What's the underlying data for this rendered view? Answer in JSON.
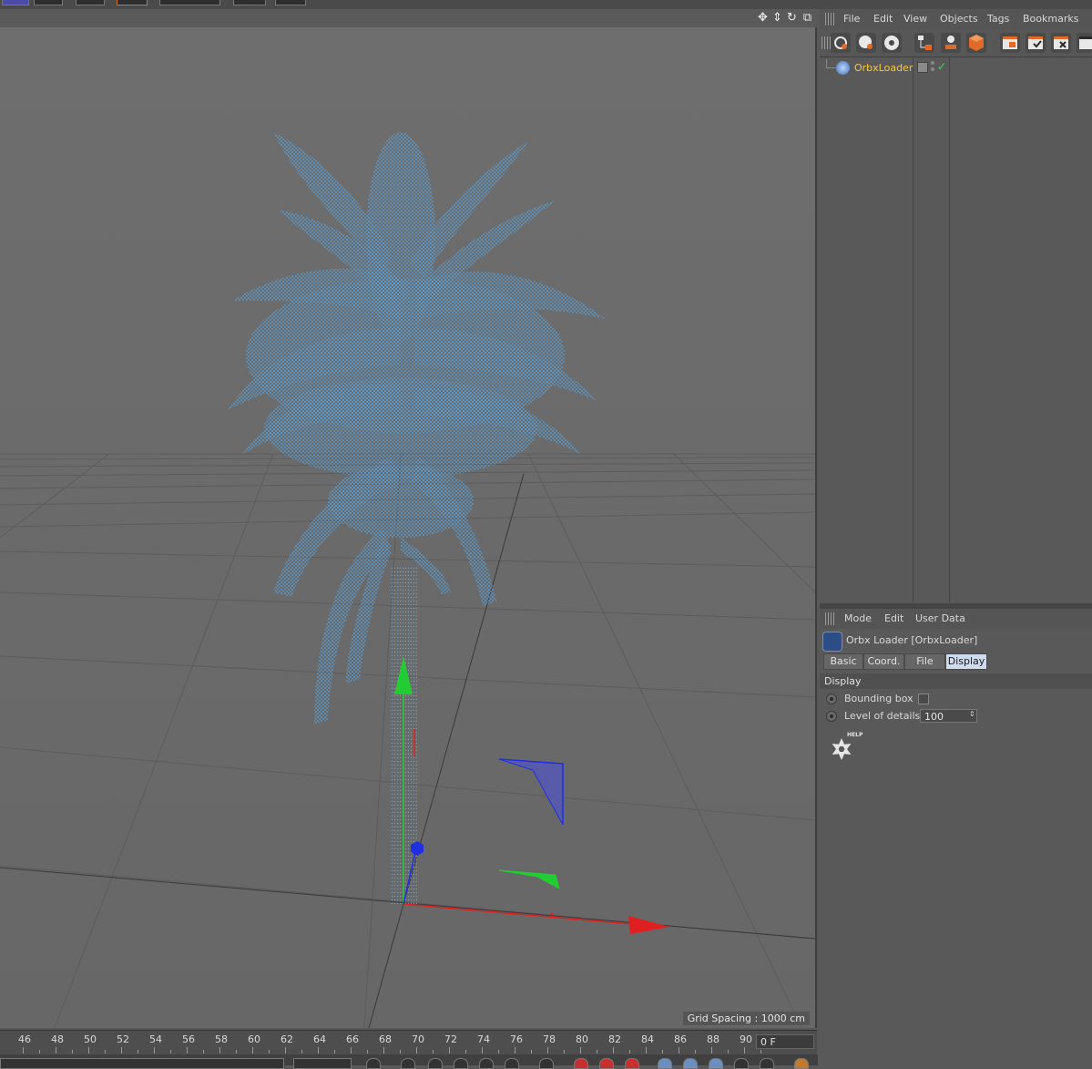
{
  "viewport": {
    "grid_spacing": "Grid Spacing : 1000 cm",
    "nav_icons": [
      "move-view-icon",
      "zoom-view-icon",
      "rotate-view-icon",
      "toggle-layout-icon"
    ]
  },
  "timeline": {
    "ticks": [
      "46",
      "48",
      "50",
      "52",
      "54",
      "56",
      "58",
      "60",
      "62",
      "64",
      "66",
      "68",
      "70",
      "72",
      "74",
      "76",
      "78",
      "80",
      "82",
      "84",
      "86",
      "88",
      "90"
    ],
    "current_frame": "0 F"
  },
  "object_manager": {
    "menu": [
      "File",
      "Edit",
      "View",
      "Objects",
      "Tags",
      "Bookmarks"
    ],
    "objects": [
      {
        "name": "OrbxLoader",
        "enabled": "✓"
      }
    ]
  },
  "attribute_manager": {
    "menu": [
      "Mode",
      "Edit",
      "User Data"
    ],
    "title": "Orbx Loader [OrbxLoader]",
    "tabs": [
      "Basic",
      "Coord.",
      "File",
      "Display"
    ],
    "active_tab": "Display",
    "section": "Display",
    "fields": {
      "bounding_box_label": "Bounding box",
      "level_of_details_label": "Level of details",
      "level_of_details_value": "100"
    },
    "help_label": "HELP"
  },
  "colors": {
    "point_cloud": "#4aa8f2",
    "axis_x": "#e02020",
    "axis_y": "#22cc33",
    "axis_z": "#2030e0",
    "object_name": "#f2c94c",
    "active_tab": "#cfdcef"
  }
}
